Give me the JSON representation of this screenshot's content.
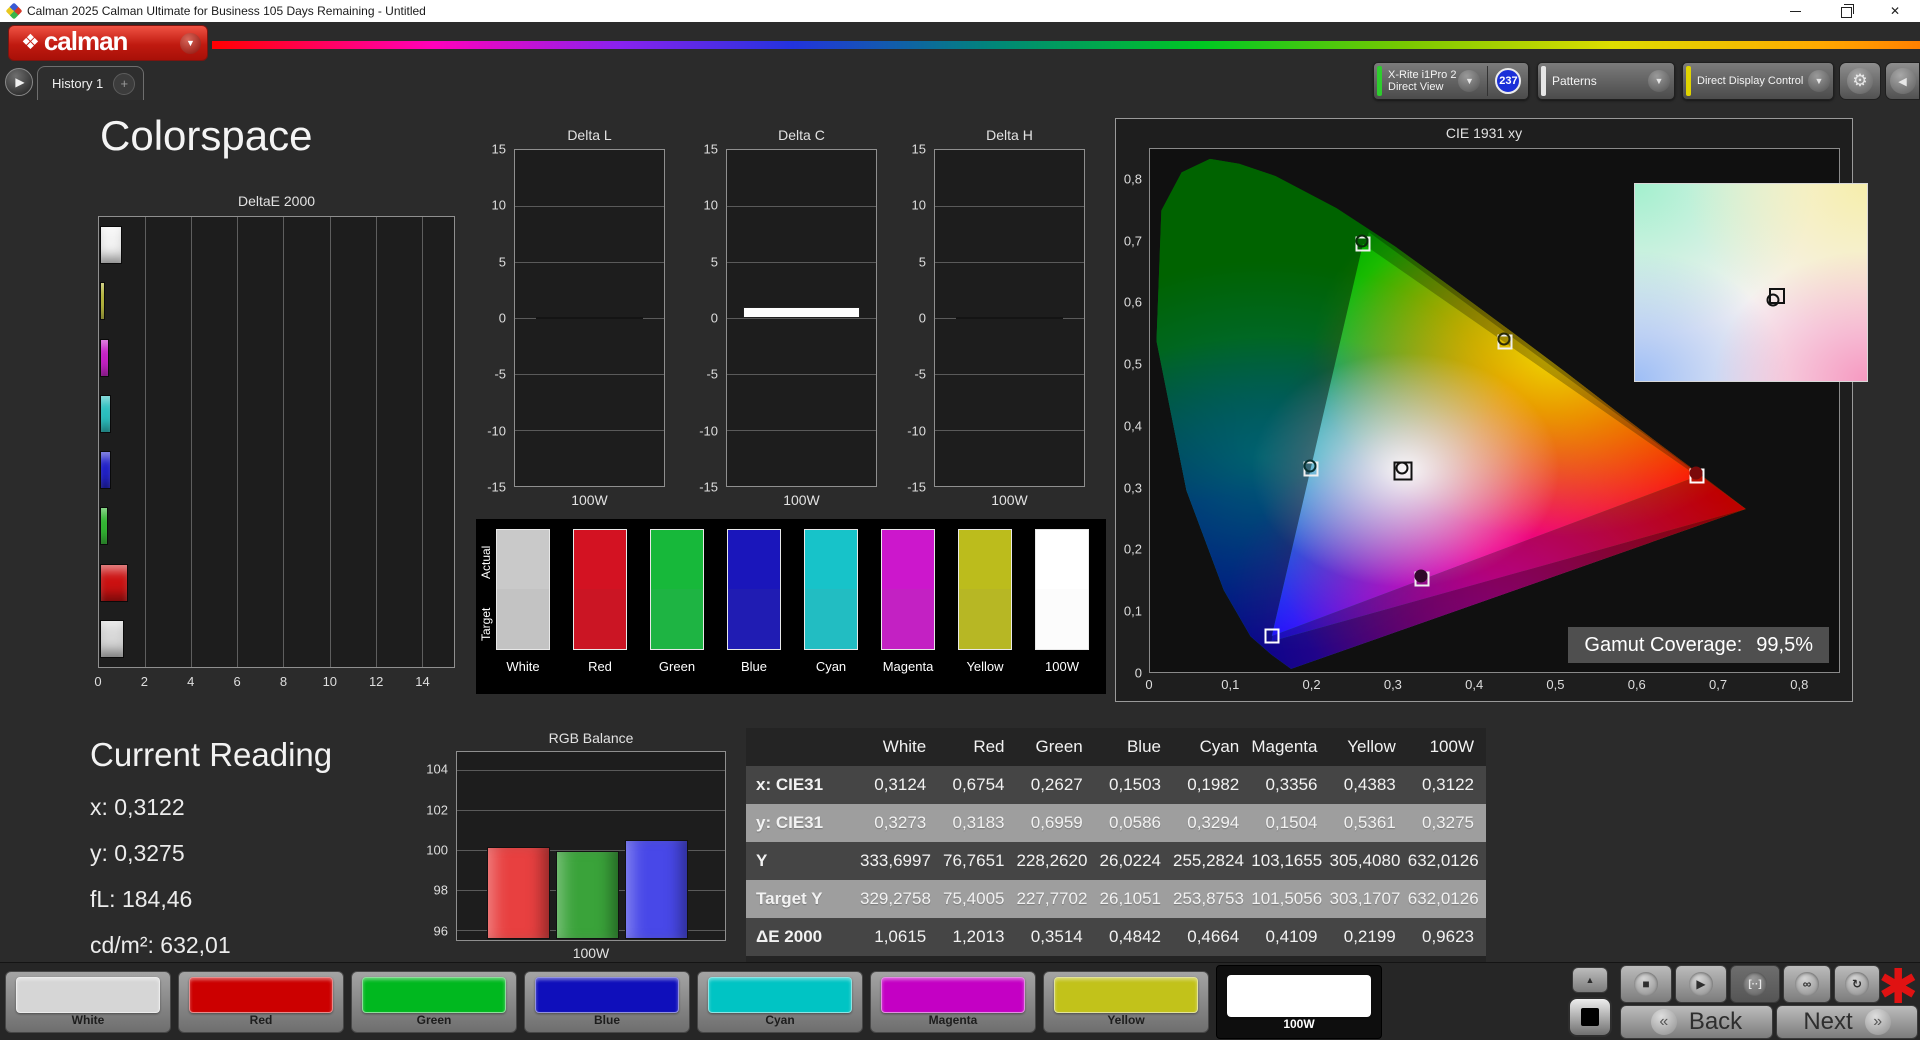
{
  "window": {
    "title": "Calman 2025 Calman Ultimate for Business 105 Days Remaining  - Untitled",
    "close_glyph": "✕"
  },
  "brand": {
    "logo_text": "calman",
    "logo_diamond": "❖"
  },
  "tab_bar": {
    "tab": "History 1",
    "add": "+"
  },
  "toolbar": {
    "meter_line1": "X-Rite i1Pro 2",
    "meter_line2": "Direct View",
    "meter_badge": "237",
    "patterns_label": "Patterns",
    "display_control_label": "Direct Display Control"
  },
  "accents": {
    "meter": "#2ecc2e",
    "patterns": "#e6e6e6",
    "display_control": "#e0d400",
    "badge_blue": "#1a2fd8"
  },
  "page_title": "Colorspace",
  "current_reading": {
    "title": "Current Reading",
    "x": "x: 0,3122",
    "y": "y: 0,3275",
    "fl": "fL: 184,46",
    "cdm2": "cd/m²: 632,01"
  },
  "gamut": {
    "label": "Gamut Coverage:",
    "value": "99,5%"
  },
  "swatch_grid": {
    "row_labels": [
      "Actual",
      "Target"
    ],
    "columns": [
      {
        "label": "White",
        "actual": "#c9c9c9",
        "target": "#c3c3c3"
      },
      {
        "label": "Red",
        "actual": "#d31222",
        "target": "#cb1524"
      },
      {
        "label": "Green",
        "actual": "#17b83a",
        "target": "#1eb443"
      },
      {
        "label": "Blue",
        "actual": "#1a16bb",
        "target": "#201cb3"
      },
      {
        "label": "Cyan",
        "actual": "#17c3c9",
        "target": "#22bdc2"
      },
      {
        "label": "Magenta",
        "actual": "#cc17cc",
        "target": "#c321c3"
      },
      {
        "label": "Yellow",
        "actual": "#bcbc1c",
        "target": "#b7b724"
      },
      {
        "label": "100W",
        "actual": "#ffffff",
        "target": "#fcfcfc"
      }
    ]
  },
  "table": {
    "columns": [
      "White",
      "Red",
      "Green",
      "Blue",
      "Cyan",
      "Magenta",
      "Yellow",
      "100W"
    ],
    "rows": [
      {
        "label": "x: CIE31",
        "highlight": false,
        "values": [
          "0,3124",
          "0,6754",
          "0,2627",
          "0,1503",
          "0,1982",
          "0,3356",
          "0,4383",
          "0,3122"
        ]
      },
      {
        "label": "y: CIE31",
        "highlight": true,
        "values": [
          "0,3273",
          "0,3183",
          "0,6959",
          "0,0586",
          "0,3294",
          "0,1504",
          "0,5361",
          "0,3275"
        ]
      },
      {
        "label": "Y",
        "highlight": false,
        "values": [
          "333,6997",
          "76,7651",
          "228,2620",
          "26,0224",
          "255,2824",
          "103,1655",
          "305,4080",
          "632,0126"
        ]
      },
      {
        "label": "Target Y",
        "highlight": true,
        "values": [
          "329,2758",
          "75,4005",
          "227,7702",
          "26,1051",
          "253,8753",
          "101,5056",
          "303,1707",
          "632,0126"
        ]
      },
      {
        "label": "ΔE 2000",
        "highlight": false,
        "values": [
          "1,0615",
          "1,2013",
          "0,3514",
          "0,4842",
          "0,4664",
          "0,4109",
          "0,2199",
          "0,9623"
        ]
      }
    ]
  },
  "pattern_buttons": [
    {
      "label": "White",
      "color": "#d6d6d6",
      "selected": false
    },
    {
      "label": "Red",
      "color": "#cc0000",
      "selected": false
    },
    {
      "label": "Green",
      "color": "#00b81f",
      "selected": false
    },
    {
      "label": "Blue",
      "color": "#0f0fbb",
      "selected": false
    },
    {
      "label": "Cyan",
      "color": "#00c4c4",
      "selected": false
    },
    {
      "label": "Magenta",
      "color": "#c400c4",
      "selected": false
    },
    {
      "label": "Yellow",
      "color": "#c2c21a",
      "selected": false
    },
    {
      "label": "100W",
      "color": "#ffffff",
      "selected": true
    }
  ],
  "controls": {
    "up": "▲",
    "stop": "■",
    "play": "▶",
    "bracket": "[··]",
    "infinity": "∞",
    "refresh": "↻",
    "asterisk": "✱",
    "back": "Back",
    "next": "Next",
    "back_chev": "«",
    "next_chev": "»",
    "play_tab": "▶",
    "dd_chev": "▼",
    "gear": "⚙",
    "panel_chev": "◀"
  },
  "chart_data": [
    {
      "id": "deltae2000",
      "type": "bar",
      "orientation": "horizontal",
      "title": "DeltaE 2000",
      "xlabel": "",
      "ylabel": "",
      "xlim": [
        0,
        15.4
      ],
      "xticks": [
        0,
        2,
        4,
        6,
        8,
        10,
        12,
        14
      ],
      "categories": [
        "100W",
        "Yellow",
        "Magenta",
        "Cyan",
        "Blue",
        "Green",
        "Red",
        "White"
      ],
      "values": [
        0.9623,
        0.2199,
        0.4109,
        0.4664,
        0.4842,
        0.3514,
        1.2013,
        1.0615
      ],
      "colors": [
        "#f2f2f2",
        "#b8b822",
        "#cc12cc",
        "#22c4c4",
        "#1818cc",
        "#22b822",
        "#cc1111",
        "#d8d8d8"
      ]
    },
    {
      "id": "delta_l",
      "type": "bar",
      "title": "Delta L",
      "ylim": [
        -15,
        15
      ],
      "yticks": [
        15,
        10,
        5,
        0,
        -5,
        -10,
        -15
      ],
      "categories": [
        "100W"
      ],
      "values": [
        0.0
      ],
      "bar_color": "#141414"
    },
    {
      "id": "delta_c",
      "type": "bar",
      "title": "Delta C",
      "ylim": [
        -15,
        15
      ],
      "yticks": [
        15,
        10,
        5,
        0,
        -5,
        -10,
        -15
      ],
      "categories": [
        "100W"
      ],
      "values": [
        1.0
      ],
      "bar_color": "#ffffff"
    },
    {
      "id": "delta_h",
      "type": "bar",
      "title": "Delta H",
      "ylim": [
        -15,
        15
      ],
      "yticks": [
        15,
        10,
        5,
        0,
        -5,
        -10,
        -15
      ],
      "categories": [
        "100W"
      ],
      "values": [
        0.0
      ],
      "bar_color": "#141414"
    },
    {
      "id": "rgb_balance",
      "type": "bar",
      "title": "RGB Balance",
      "xlabel": "100W",
      "ylim": [
        95.5,
        104.9
      ],
      "yticks": [
        104,
        102,
        100,
        98,
        96
      ],
      "categories": [
        "Red",
        "Green",
        "Blue"
      ],
      "values": [
        100.1,
        99.9,
        100.45
      ],
      "colors": [
        "#e84040",
        "#3aa33a",
        "#4848e8"
      ]
    },
    {
      "id": "cie",
      "type": "scatter",
      "title": "CIE 1931 xy",
      "xlim": [
        0,
        0.85
      ],
      "ylim": [
        0,
        0.85
      ],
      "xticks": [
        {
          "v": 0,
          "label": "0"
        },
        {
          "v": 0.1,
          "label": "0,1"
        },
        {
          "v": 0.2,
          "label": "0,2"
        },
        {
          "v": 0.3,
          "label": "0,3"
        },
        {
          "v": 0.4,
          "label": "0,4"
        },
        {
          "v": 0.5,
          "label": "0,5"
        },
        {
          "v": 0.6,
          "label": "0,6"
        },
        {
          "v": 0.7,
          "label": "0,7"
        },
        {
          "v": 0.8,
          "label": "0,8"
        }
      ],
      "yticks": [
        {
          "v": 0,
          "label": "0"
        },
        {
          "v": 0.1,
          "label": "0,1"
        },
        {
          "v": 0.2,
          "label": "0,2"
        },
        {
          "v": 0.3,
          "label": "0,3"
        },
        {
          "v": 0.4,
          "label": "0,4"
        },
        {
          "v": 0.5,
          "label": "0,5"
        },
        {
          "v": 0.6,
          "label": "0,6"
        },
        {
          "v": 0.7,
          "label": "0,7"
        },
        {
          "v": 0.8,
          "label": "0,8"
        }
      ],
      "gamut_triangle": {
        "red": [
          0.6754,
          0.3183
        ],
        "green": [
          0.2627,
          0.6959
        ],
        "blue": [
          0.1503,
          0.0586
        ]
      },
      "points": [
        {
          "name": "white",
          "x": 0.3124,
          "y": 0.3273,
          "square": "#111111",
          "circle": "#111111",
          "size": 19
        },
        {
          "name": "red",
          "x": 0.6754,
          "y": 0.3183,
          "square": "#ffffff",
          "circle": "#7a0a0a",
          "circle_filled": true,
          "size": 15
        },
        {
          "name": "green",
          "x": 0.2627,
          "y": 0.6959,
          "square": "#f0f0f0",
          "circle": "#0a2a0a",
          "size": 15
        },
        {
          "name": "blue",
          "x": 0.1503,
          "y": 0.0586,
          "square": "#ffffff",
          "circle": null,
          "size": 15
        },
        {
          "name": "cyan",
          "x": 0.1982,
          "y": 0.3294,
          "square": "#f0f0f0",
          "circle": "#083030",
          "size": 15
        },
        {
          "name": "magenta",
          "x": 0.3356,
          "y": 0.1504,
          "square": "#f0f0f0",
          "circle": "#30082a",
          "circle_filled": true,
          "size": 15
        },
        {
          "name": "yellow",
          "x": 0.4383,
          "y": 0.5361,
          "square": "#f0f0f0",
          "circle": "#2a2a08",
          "size": 15
        }
      ],
      "inset_marker": {
        "x": 0.61,
        "y": 0.43
      },
      "legend": "Gamut Coverage: 99,5%"
    }
  ]
}
